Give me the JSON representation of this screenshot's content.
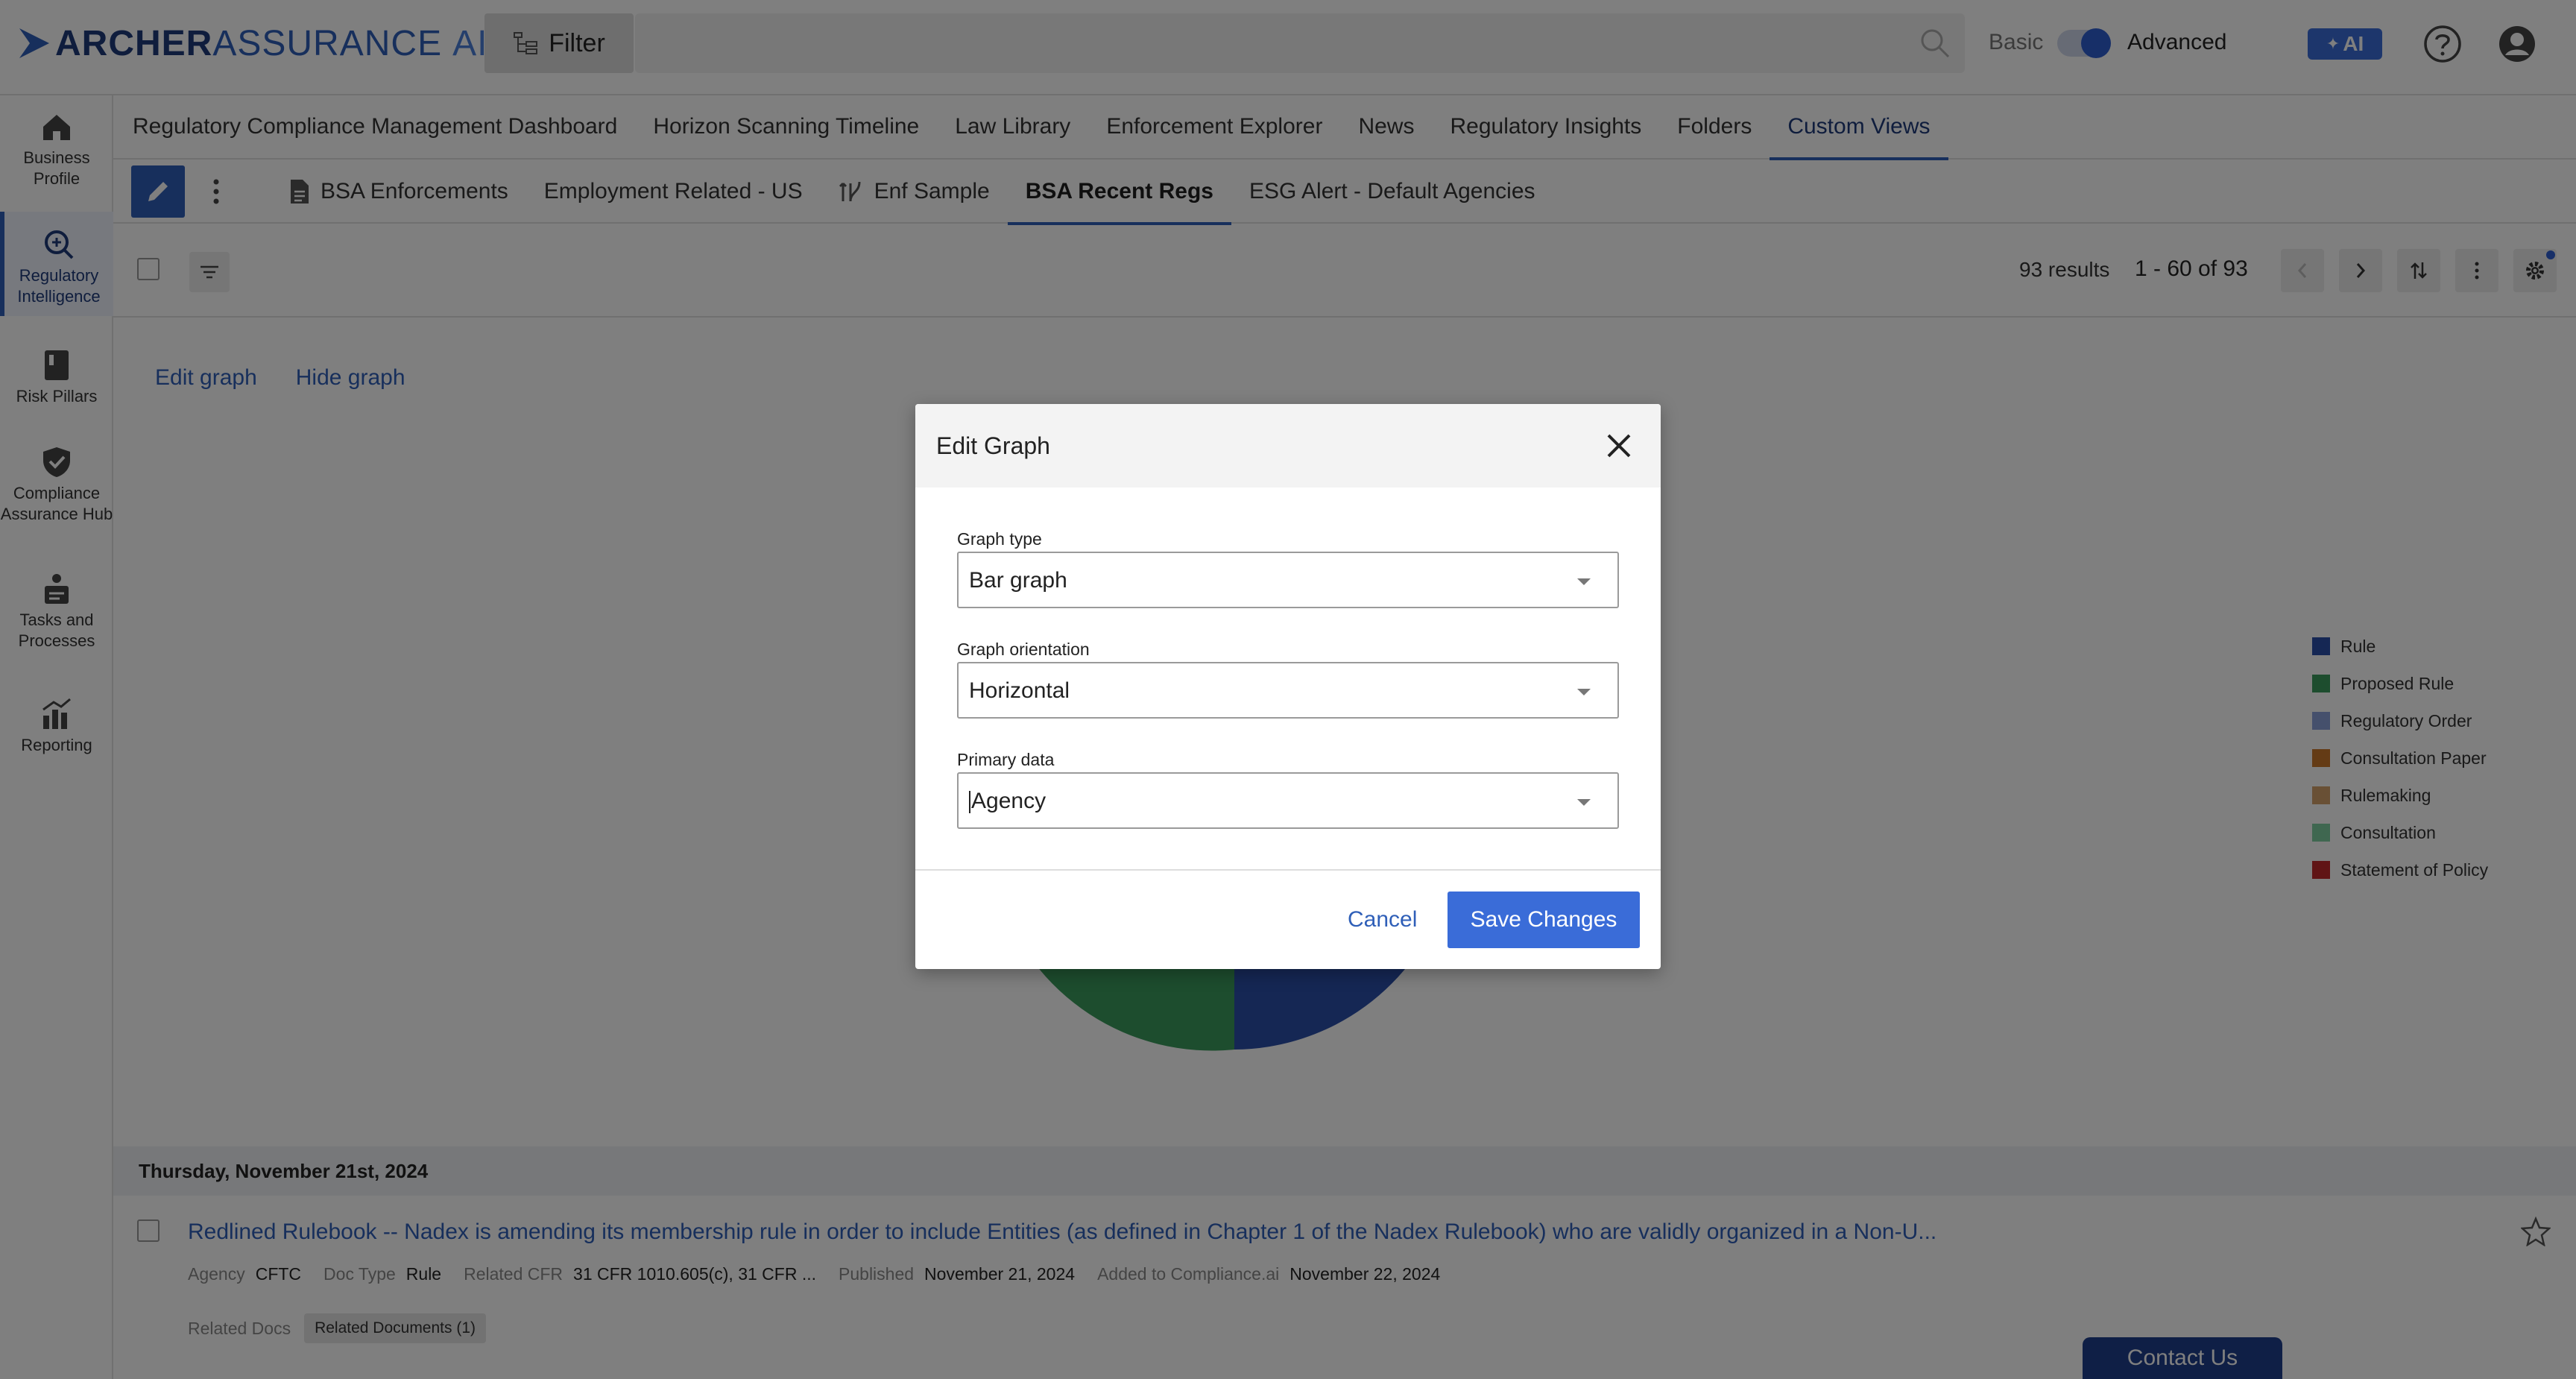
{
  "header": {
    "logo_main": "ARCHER",
    "logo_sub": "ASSURANCE",
    "logo_ai": "AI",
    "filter_label": "Filter",
    "mode_basic": "Basic",
    "mode_advanced": "Advanced",
    "ai_button": "AI"
  },
  "sidebar": {
    "items": [
      {
        "label": "Business Profile",
        "icon": "home-icon"
      },
      {
        "label": "Regulatory Intelligence",
        "icon": "search-icon",
        "active": true
      },
      {
        "label": "Risk Pillars",
        "icon": "book-icon"
      },
      {
        "label": "Compliance Assurance Hub",
        "icon": "shield-check-icon"
      },
      {
        "label": "Tasks and Processes",
        "icon": "tasks-icon"
      },
      {
        "label": "Reporting",
        "icon": "chart-icon"
      }
    ]
  },
  "nav": {
    "tabs": [
      {
        "label": "Regulatory Compliance Management Dashboard"
      },
      {
        "label": "Horizon Scanning Timeline"
      },
      {
        "label": "Law Library"
      },
      {
        "label": "Enforcement Explorer"
      },
      {
        "label": "News"
      },
      {
        "label": "Regulatory Insights"
      },
      {
        "label": "Folders"
      },
      {
        "label": "Custom Views",
        "active": true
      }
    ],
    "subtabs": [
      {
        "label": "BSA Enforcements",
        "icon": "document-icon"
      },
      {
        "label": "Employment Related - US"
      },
      {
        "label": "Enf Sample",
        "icon": "timeline-icon"
      },
      {
        "label": "BSA Recent Regs",
        "active": true
      },
      {
        "label": "ESG Alert - Default Agencies"
      }
    ]
  },
  "toolbar": {
    "results": "93 results",
    "range": "1 - 60 of 93"
  },
  "graph": {
    "edit_link": "Edit graph",
    "hide_link": "Hide graph",
    "legend": [
      {
        "label": "Rule",
        "color": "#2a4fa8"
      },
      {
        "label": "Proposed Rule",
        "color": "#3a9a5c"
      },
      {
        "label": "Regulatory Order",
        "color": "#8aa0d8"
      },
      {
        "label": "Consultation Paper",
        "color": "#c8762a"
      },
      {
        "label": "Rulemaking",
        "color": "#d2a06a"
      },
      {
        "label": "Consultation",
        "color": "#7fcfa0"
      },
      {
        "label": "Statement of Policy",
        "color": "#c0282a"
      }
    ]
  },
  "list": {
    "date_header": "Thursday, November 21st, 2024",
    "item": {
      "title": "Redlined Rulebook -- Nadex is amending its membership rule in order to include Entities (as defined in Chapter 1 of the Nadex Rulebook) who are validly organized in a Non-U...",
      "agency_label": "Agency",
      "agency": "CFTC",
      "doctype_label": "Doc Type",
      "doctype": "Rule",
      "cfr_label": "Related CFR",
      "cfr": "31 CFR 1010.605(c), 31 CFR ...",
      "published_label": "Published",
      "published": "November 21, 2024",
      "added_label": "Added to Compliance.ai",
      "added": "November 22, 2024",
      "related_label": "Related Docs",
      "related_button": "Related Documents (1)"
    }
  },
  "contact": "Contact Us",
  "modal": {
    "title": "Edit Graph",
    "graph_type_label": "Graph type",
    "graph_type_value": "Bar graph",
    "orientation_label": "Graph orientation",
    "orientation_value": "Horizontal",
    "primary_label": "Primary data",
    "primary_value": "Agency",
    "cancel": "Cancel",
    "save": "Save Changes"
  }
}
